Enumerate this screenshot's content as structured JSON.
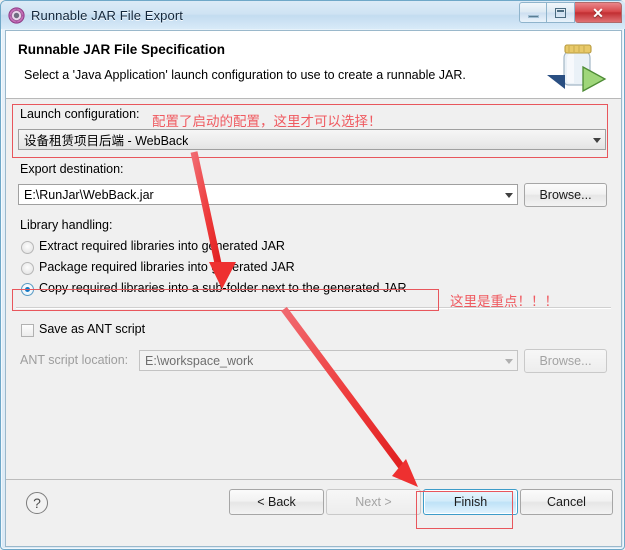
{
  "window": {
    "title": "Runnable JAR File Export",
    "icon": "jar-export-icon",
    "minimize_label": "Minimize",
    "maximize_label": "Maximize",
    "close_label": "Close"
  },
  "header": {
    "title": "Runnable JAR File Specification",
    "description": "Select a 'Java Application' launch configuration to use to create a runnable JAR.",
    "icon": "runnable-jar-icon"
  },
  "form": {
    "launch_configuration_label": "Launch configuration:",
    "launch_configuration_value": "设备租赁项目后端 - WebBack",
    "export_destination_label": "Export destination:",
    "export_destination_value": "E:\\RunJar\\WebBack.jar",
    "browse_destination_label": "Browse...",
    "library_handling_label": "Library handling:",
    "library_options": [
      {
        "label": "Extract required libraries into generated JAR",
        "selected": false
      },
      {
        "label": "Package required libraries into generated JAR",
        "selected": false
      },
      {
        "label": "Copy required libraries into a sub-folder next to the generated JAR",
        "selected": true
      }
    ],
    "save_ant_label": "Save as ANT script",
    "save_ant_checked": false,
    "ant_location_label": "ANT script location:",
    "ant_location_value": "E:\\workspace_work",
    "browse_ant_label": "Browse..."
  },
  "buttons": {
    "help_label": "?",
    "back_label": "< Back",
    "next_label": "Next >",
    "finish_label": "Finish",
    "cancel_label": "Cancel"
  },
  "annotations": {
    "launch_note": "配置了启动的配置，这里才可以选择！",
    "copy_note": "这里是重点！！！",
    "color": "#ef5a60"
  }
}
